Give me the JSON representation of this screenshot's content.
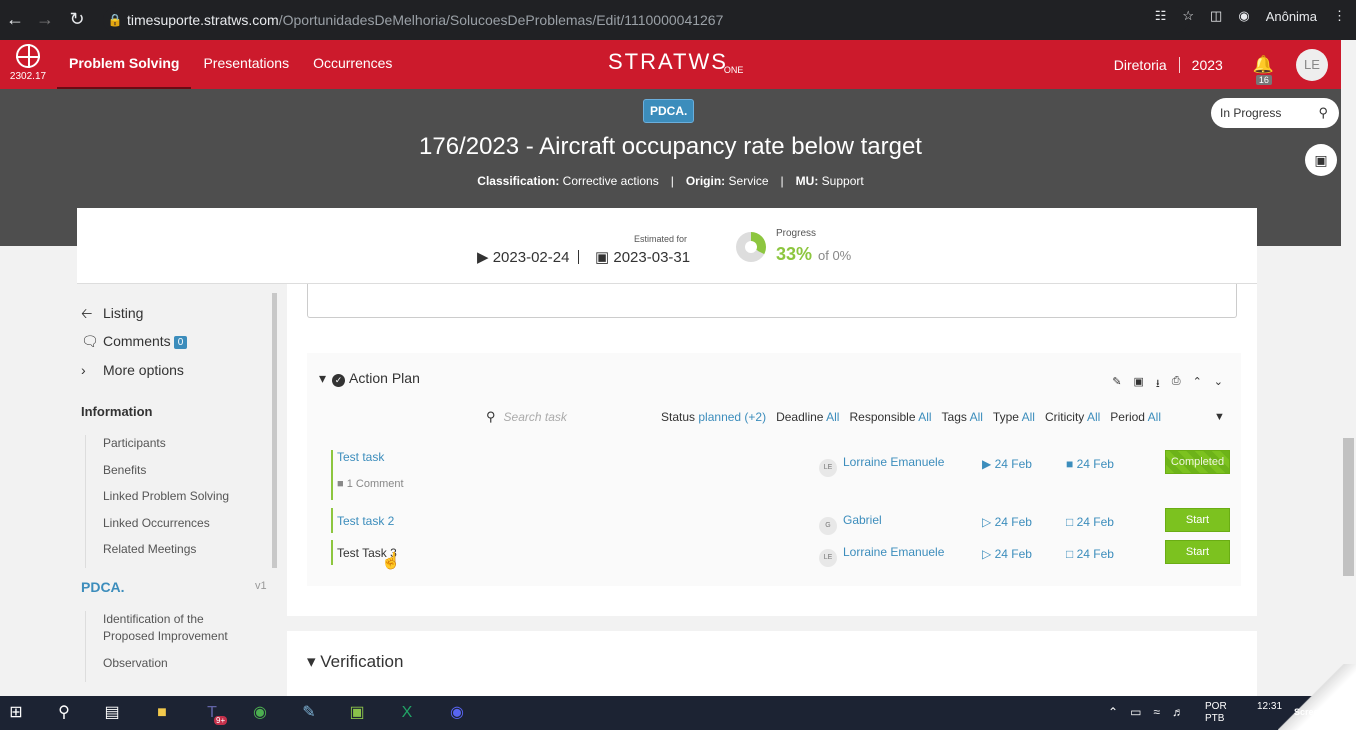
{
  "browser": {
    "url_host": "timesuporte.stratws.com",
    "url_path": "/OportunidadesDeMelhoria/SolucoesDeProblemas/Edit/1110000041267",
    "profile": "Anônima"
  },
  "header": {
    "version": "2302.17",
    "nav": [
      "Problem Solving",
      "Presentations",
      "Occurrences"
    ],
    "brand": "STRATWS",
    "brand_suffix": "ONE",
    "board": "Diretoria",
    "year": "2023",
    "notification_count": "16",
    "user_initials": "LE",
    "accent": "#cc1a2c"
  },
  "hero": {
    "method_badge": "PDCA.",
    "title": "176/2023 - Aircraft occupancy rate below target",
    "classification_label": "Classification:",
    "classification": "Corrective actions",
    "origin_label": "Origin:",
    "origin": "Service",
    "mu_label": "MU:",
    "mu": "Support",
    "status": "In Progress"
  },
  "dates": {
    "start": "2023-02-24",
    "estimated_label": "Estimated for",
    "end": "2023-03-31",
    "progress_label": "Progress",
    "progress_value": "33%",
    "progress_of": "of 0%",
    "progress_fraction": 0.33
  },
  "sidebar": {
    "listing": "Listing",
    "comments": "Comments",
    "comments_count": "0",
    "more_options": "More options",
    "information": "Information",
    "info_items": [
      "Participants",
      "Benefits",
      "Linked Problem Solving",
      "Linked Occurrences",
      "Related Meetings"
    ],
    "pdca": "PDCA.",
    "pdca_version": "v1",
    "pdca_items": [
      "Identification of the Proposed Improvement",
      "Observation"
    ]
  },
  "action_plan": {
    "title": "Action Plan",
    "search_placeholder": "Search task",
    "filters": [
      {
        "label": "Status",
        "value": "planned (+2)"
      },
      {
        "label": "Deadline",
        "value": "All"
      },
      {
        "label": "Responsible",
        "value": "All"
      },
      {
        "label": "Tags",
        "value": "All"
      },
      {
        "label": "Type",
        "value": "All"
      },
      {
        "label": "Criticity",
        "value": "All"
      },
      {
        "label": "Period",
        "value": "All"
      }
    ],
    "tasks": [
      {
        "name": "Test task",
        "comments": "1 Comment",
        "initials": "LE",
        "responsible": "Lorraine Emanuele",
        "start": "24 Feb",
        "end": "24 Feb",
        "action": "Completed"
      },
      {
        "name": "Test task 2",
        "comments": "",
        "initials": "G",
        "responsible": "Gabriel",
        "start": "24 Feb",
        "end": "24 Feb",
        "action": "Start"
      },
      {
        "name": "Test Task 3",
        "comments": "",
        "initials": "LE",
        "responsible": "Lorraine Emanuele",
        "start": "24 Feb",
        "end": "24 Feb",
        "action": "Start"
      }
    ]
  },
  "verification": {
    "title": "Verification"
  },
  "taskbar": {
    "lang1": "POR",
    "lang2": "PTB",
    "time": "12:31",
    "screenpresso": "Screenpresso",
    "teams_badge": "9+"
  }
}
